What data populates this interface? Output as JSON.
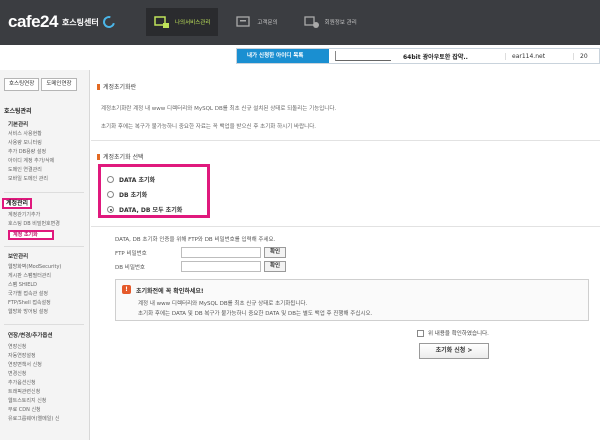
{
  "header": {
    "logo_text": "cafe24",
    "logo_sub": "호스팅센터",
    "nav": [
      {
        "label": "나의서비스관리",
        "active": true,
        "icon": "service-manage-icon"
      },
      {
        "label": "고객문의",
        "active": false,
        "icon": "customer-inquiry-icon"
      },
      {
        "label": "회원정보 관리",
        "active": false,
        "icon": "member-info-icon"
      }
    ],
    "accent_color": "#bfe35a"
  },
  "service_bar": {
    "label": "내가 신청한 아이디 목록",
    "service_name": "64bit 광아우토한 잡약..",
    "domain": "ear114.net",
    "extra": "20"
  },
  "sidebar": {
    "tabs": [
      "호스팅연장",
      "도메인연장"
    ],
    "sections": {
      "hosting_manage": "호스팅관리",
      "basic": "기본관리",
      "basic_items": [
        "서비스 사용현황",
        "사용량 모니터링",
        "추가 DB용량 설정",
        "아이디 계정 추가/삭제",
        "도메인 연결관리",
        "모바일 도메인 관리"
      ],
      "account": "계정관리",
      "account_items": [
        "계정관기기추가",
        "호스팅 DB 비밀번호변경"
      ],
      "account_active": "계정 초기화",
      "security": "보안관리",
      "security_items": [
        "웹방화벽(ModSecurity)",
        "게시판 스팸필터관리",
        "스팸 SHIELD",
        "국가별 접속관 설정",
        "FTP/Shell 접속설정",
        "웹방화 방어팅 설정"
      ],
      "extend": "연장/변경/추가옵션",
      "extend_items": [
        "연장신청",
        "자동연장설정",
        "연장면책서 신청",
        "변경신청",
        "추가옵션신청",
        "트래픽관련신청",
        "웹트스토리지 신청",
        "무료 CDN 신청",
        "유료그룹웨어(엘메일) 신"
      ]
    }
  },
  "main": {
    "section1_title": "계정초기화란",
    "section1_notes": [
      "계정초기화란 계정 내 www 디렉터리와 MySQL DB를 최초 신규 설치된 상태로 되돌리는 기능입니다.",
      "초기화 후에는 복구가 불가능하니 중요한 자료는 꼭 백업을 받으신 후 초기화 하시기 바랍니다."
    ],
    "section2_title": "계정초기화 선택",
    "options": [
      {
        "label": "DATA 초기화",
        "checked": false
      },
      {
        "label": "DB 초기화",
        "checked": false
      },
      {
        "label": "DATA, DB 모두 초기화",
        "checked": true
      }
    ],
    "auth_desc": "DATA, DB 초기화 인증을 위해 FTP와 DB 비밀번호를 입력해 주세요.",
    "ftp_label": "FTP 비밀번호",
    "db_label": "DB 비밀번호",
    "confirm_label": "확인",
    "warn_title": "초기화전에 꼭 확인하세요!",
    "warn_lines": [
      "계정 내 www 디렉터리와 MySQL DB를 최초 신규 상태로 초기화됩니다.",
      "초기화 후에는 DATA 및 DB 복구가 불가능하니 중요한 DATA 및 DB는 별도 백업 후 진행해 주십시오."
    ],
    "agree_label": "위 내용을 확인하였습니다.",
    "submit_label": "초기화 신청 >"
  }
}
